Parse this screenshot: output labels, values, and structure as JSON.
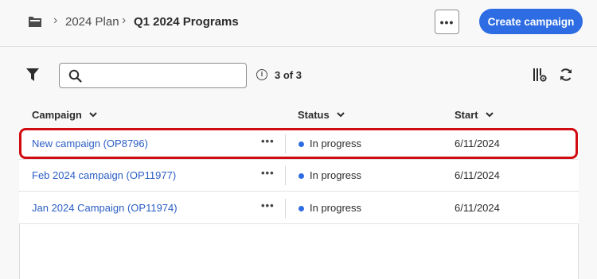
{
  "breadcrumb": {
    "icon": "folder-icon",
    "items": [
      "2024 Plan",
      "Q1 2024 Programs"
    ]
  },
  "header": {
    "more_label": "•••",
    "create_label": "Create campaign"
  },
  "toolbar": {
    "search_placeholder": "",
    "count_text": "3 of 3",
    "icons": [
      "filter-icon",
      "search-icon",
      "info-icon",
      "column-settings-icon",
      "refresh-icon"
    ]
  },
  "table": {
    "columns": [
      "Campaign",
      "Status",
      "Start"
    ],
    "row_more_label": "•••",
    "rows": [
      {
        "name": "New campaign (OP8796)",
        "status": "In progress",
        "start": "6/11/2024",
        "highlighted": true
      },
      {
        "name": "Feb 2024 campaign (OP11977)",
        "status": "In progress",
        "start": "6/11/2024",
        "highlighted": false
      },
      {
        "name": "Jan 2024 Campaign (OP11974)",
        "status": "In progress",
        "start": "6/11/2024",
        "highlighted": false
      }
    ]
  },
  "colors": {
    "accent": "#2d6ce2",
    "link": "#2b5ec5",
    "highlight": "#d00b12",
    "status_dot": "#2d6ce2"
  }
}
